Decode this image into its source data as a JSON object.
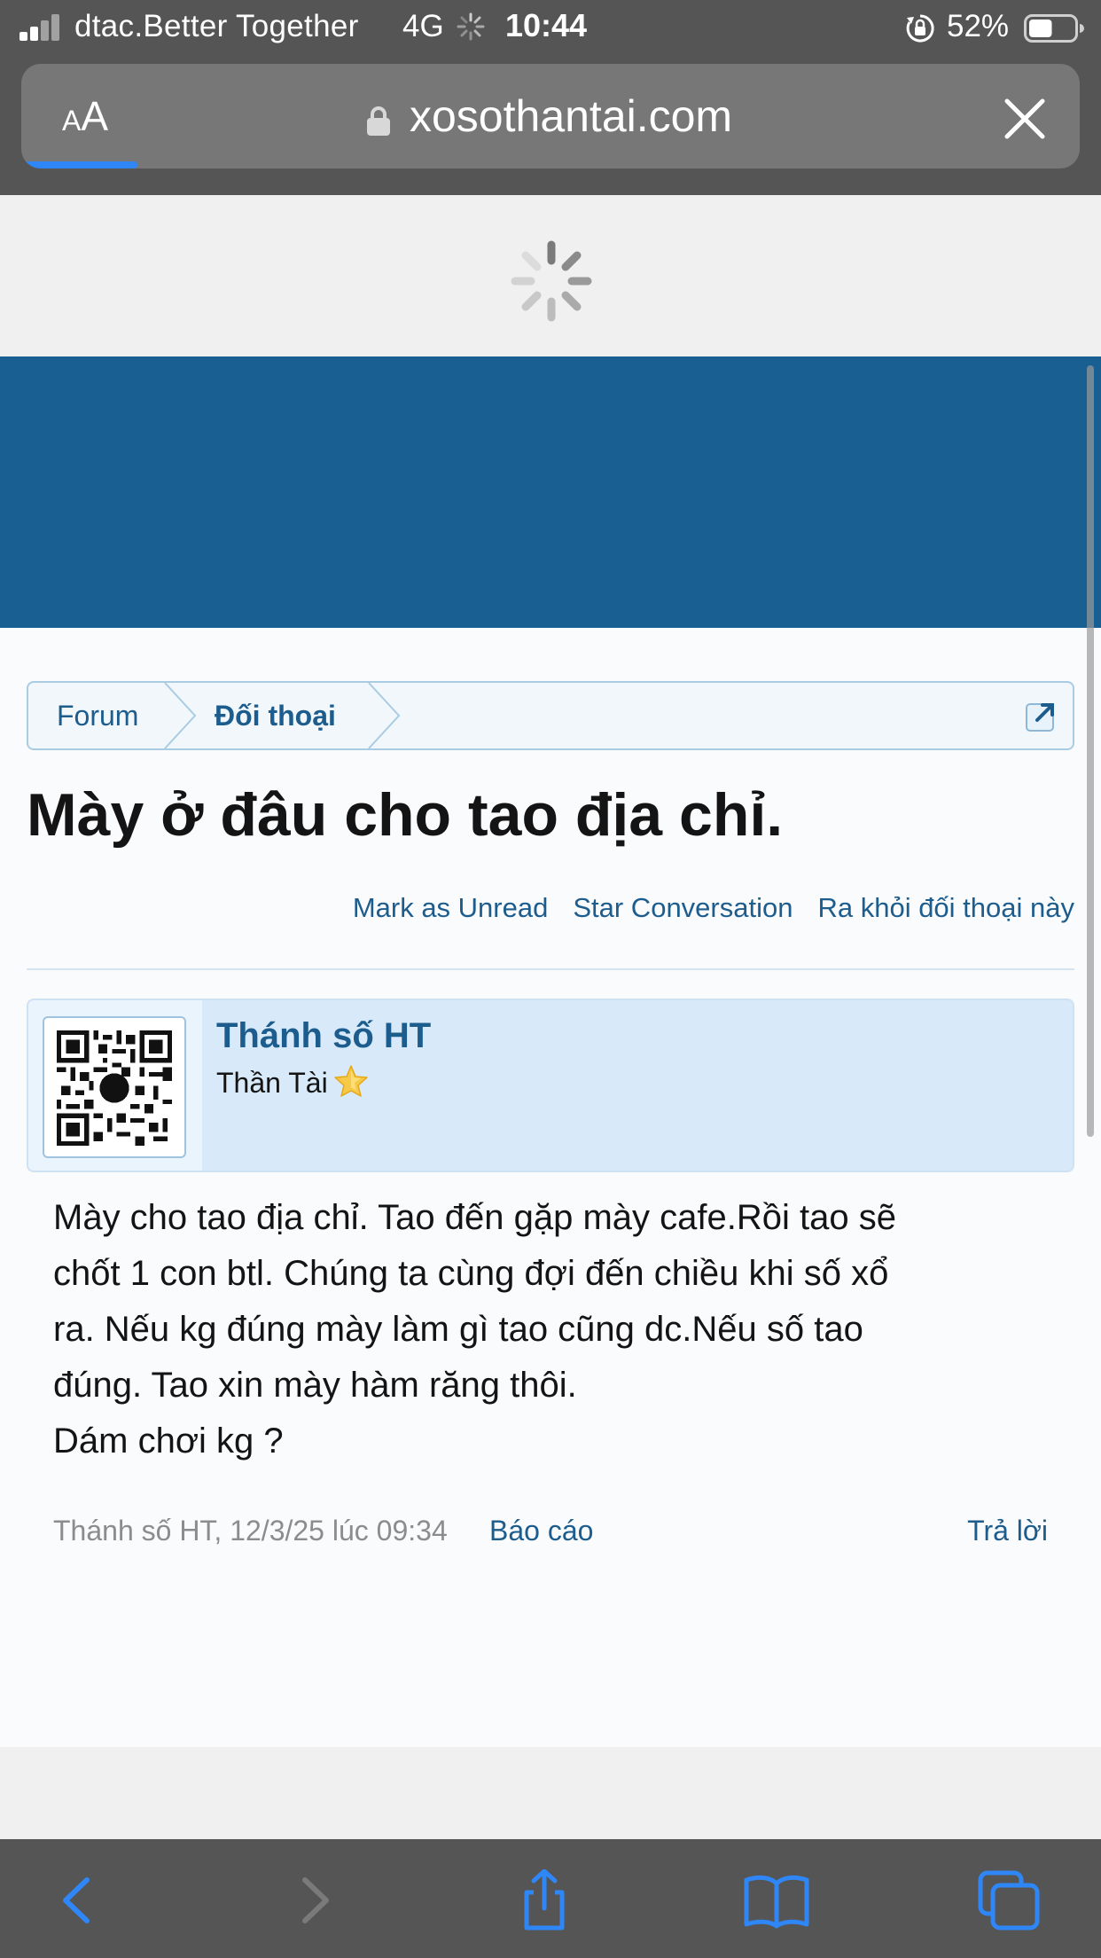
{
  "status_bar": {
    "carrier": "dtac.Better Together",
    "network": "4G",
    "time": "10:44",
    "battery_percent": "52%",
    "battery_level": 0.52
  },
  "browser": {
    "text_size_label_small": "A",
    "text_size_label_big": "A",
    "domain": "xosothantai.com",
    "load_progress": 0.11
  },
  "breadcrumb": {
    "items": [
      "Forum",
      "Đối thoại"
    ]
  },
  "conversation": {
    "title": "Mày ở đâu cho tao địa chỉ.",
    "actions": [
      "Mark as Unread",
      "Star Conversation",
      "Ra khỏi đối thoại này"
    ]
  },
  "message": {
    "username": "Thánh số HT",
    "user_title": "Thần Tài",
    "body_lines": [
      "Mày cho tao địa chỉ. Tao đến gặp mày cafe.Rồi tao sẽ",
      "chốt 1 con btl. Chúng ta cùng đợi đến chiều khi số xổ",
      "ra. Nếu kg đúng mày làm gì tao cũng dc.Nếu số tao",
      "đúng. Tao xin mày hàm răng thôi.",
      "Dám chơi kg ?"
    ],
    "meta": "Thánh số HT, 12/3/25 lúc 09:34",
    "report_label": "Báo cáo",
    "reply_label": "Trả lời"
  },
  "toolbar": {
    "icons": [
      "back-icon",
      "forward-icon",
      "share-icon",
      "bookmarks-icon",
      "tabs-icon"
    ]
  },
  "colors": {
    "header_blue": "#1a5f91",
    "link_blue": "#1d5d8e",
    "ios_blue": "#2f86f6",
    "chrome_gray": "#555555"
  }
}
